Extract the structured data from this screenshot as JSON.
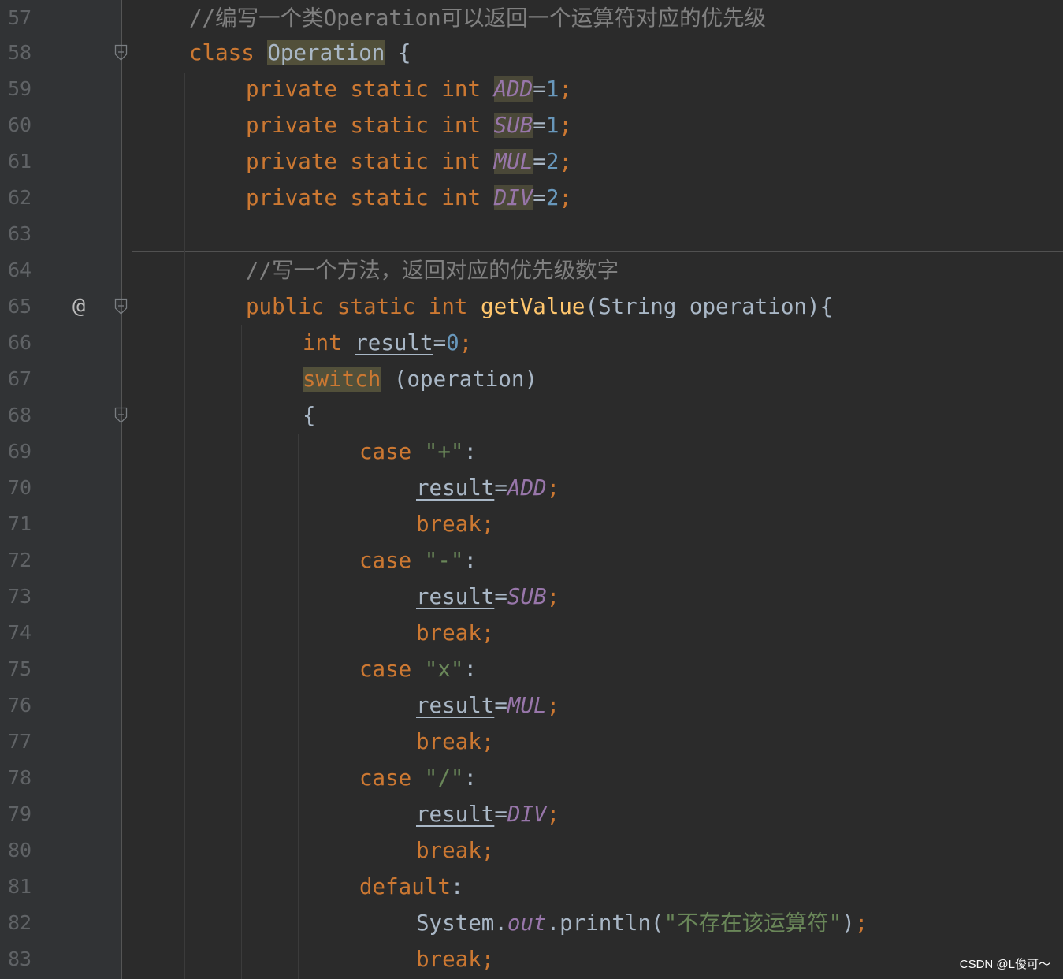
{
  "editor": {
    "line_numbers": [
      "57",
      "58",
      "59",
      "60",
      "61",
      "62",
      "63",
      "64",
      "65",
      "66",
      "67",
      "68",
      "69",
      "70",
      "71",
      "72",
      "73",
      "74",
      "75",
      "76",
      "77",
      "78",
      "79",
      "80",
      "81",
      "82",
      "83"
    ],
    "override_marker": "@",
    "code": {
      "l57": {
        "comment": "//编写一个类Operation可以返回一个运算符对应的优先级"
      },
      "l58": {
        "kw": "class",
        "name": "Operation",
        "brace": "{"
      },
      "l59": {
        "mods": "private static int",
        "field": "ADD",
        "eq": "=",
        "val": "1",
        "semi": ";"
      },
      "l60": {
        "mods": "private static int",
        "field": "SUB",
        "eq": "=",
        "val": "1",
        "semi": ";"
      },
      "l61": {
        "mods": "private static int",
        "field": "MUL",
        "eq": "=",
        "val": "2",
        "semi": ";"
      },
      "l62": {
        "mods": "private static int",
        "field": "DIV",
        "eq": "=",
        "val": "2",
        "semi": ";"
      },
      "l64": {
        "comment": "//写一个方法，返回对应的优先级数字"
      },
      "l65": {
        "mods": "public static int",
        "fn": "getValue",
        "params": "(String operation){"
      },
      "l66": {
        "kw": "int",
        "var": "result",
        "eq": "=",
        "val": "0",
        "semi": ";"
      },
      "l67": {
        "kw": "switch",
        "expr": "(operation)"
      },
      "l68": {
        "brace": "{"
      },
      "l69": {
        "kw": "case",
        "str": "\"+\"",
        "colon": ":"
      },
      "l70": {
        "var": "result",
        "eq": "=",
        "field": "ADD",
        "semi": ";"
      },
      "l71": {
        "kw": "break;"
      },
      "l72": {
        "kw": "case",
        "str": "\"-\"",
        "colon": ":"
      },
      "l73": {
        "var": "result",
        "eq": "=",
        "field": "SUB",
        "semi": ";"
      },
      "l74": {
        "kw": "break;"
      },
      "l75": {
        "kw": "case",
        "str": "\"x\"",
        "colon": ":"
      },
      "l76": {
        "var": "result",
        "eq": "=",
        "field": "MUL",
        "semi": ";"
      },
      "l77": {
        "kw": "break;"
      },
      "l78": {
        "kw": "case",
        "str": "\"/\"",
        "colon": ":"
      },
      "l79": {
        "var": "result",
        "eq": "=",
        "field": "DIV",
        "semi": ";"
      },
      "l80": {
        "kw": "break;"
      },
      "l81": {
        "kw": "default",
        "colon": ":"
      },
      "l82": {
        "cls": "System",
        "dot": ".",
        "field": "out",
        "call": ".println(",
        "str": "\"不存在该运算符\"",
        "close": ")",
        "semi": ";"
      },
      "l83": {
        "kw": "break;"
      }
    }
  },
  "watermark": "CSDN @L俊可～",
  "colors": {
    "background": "#2b2b2b",
    "gutter": "#313335",
    "keyword": "#cc7832",
    "comment": "#808080",
    "string": "#6a8759",
    "number": "#6897bb",
    "field": "#9876aa",
    "function": "#ffc66d",
    "text": "#a9b7c6"
  }
}
